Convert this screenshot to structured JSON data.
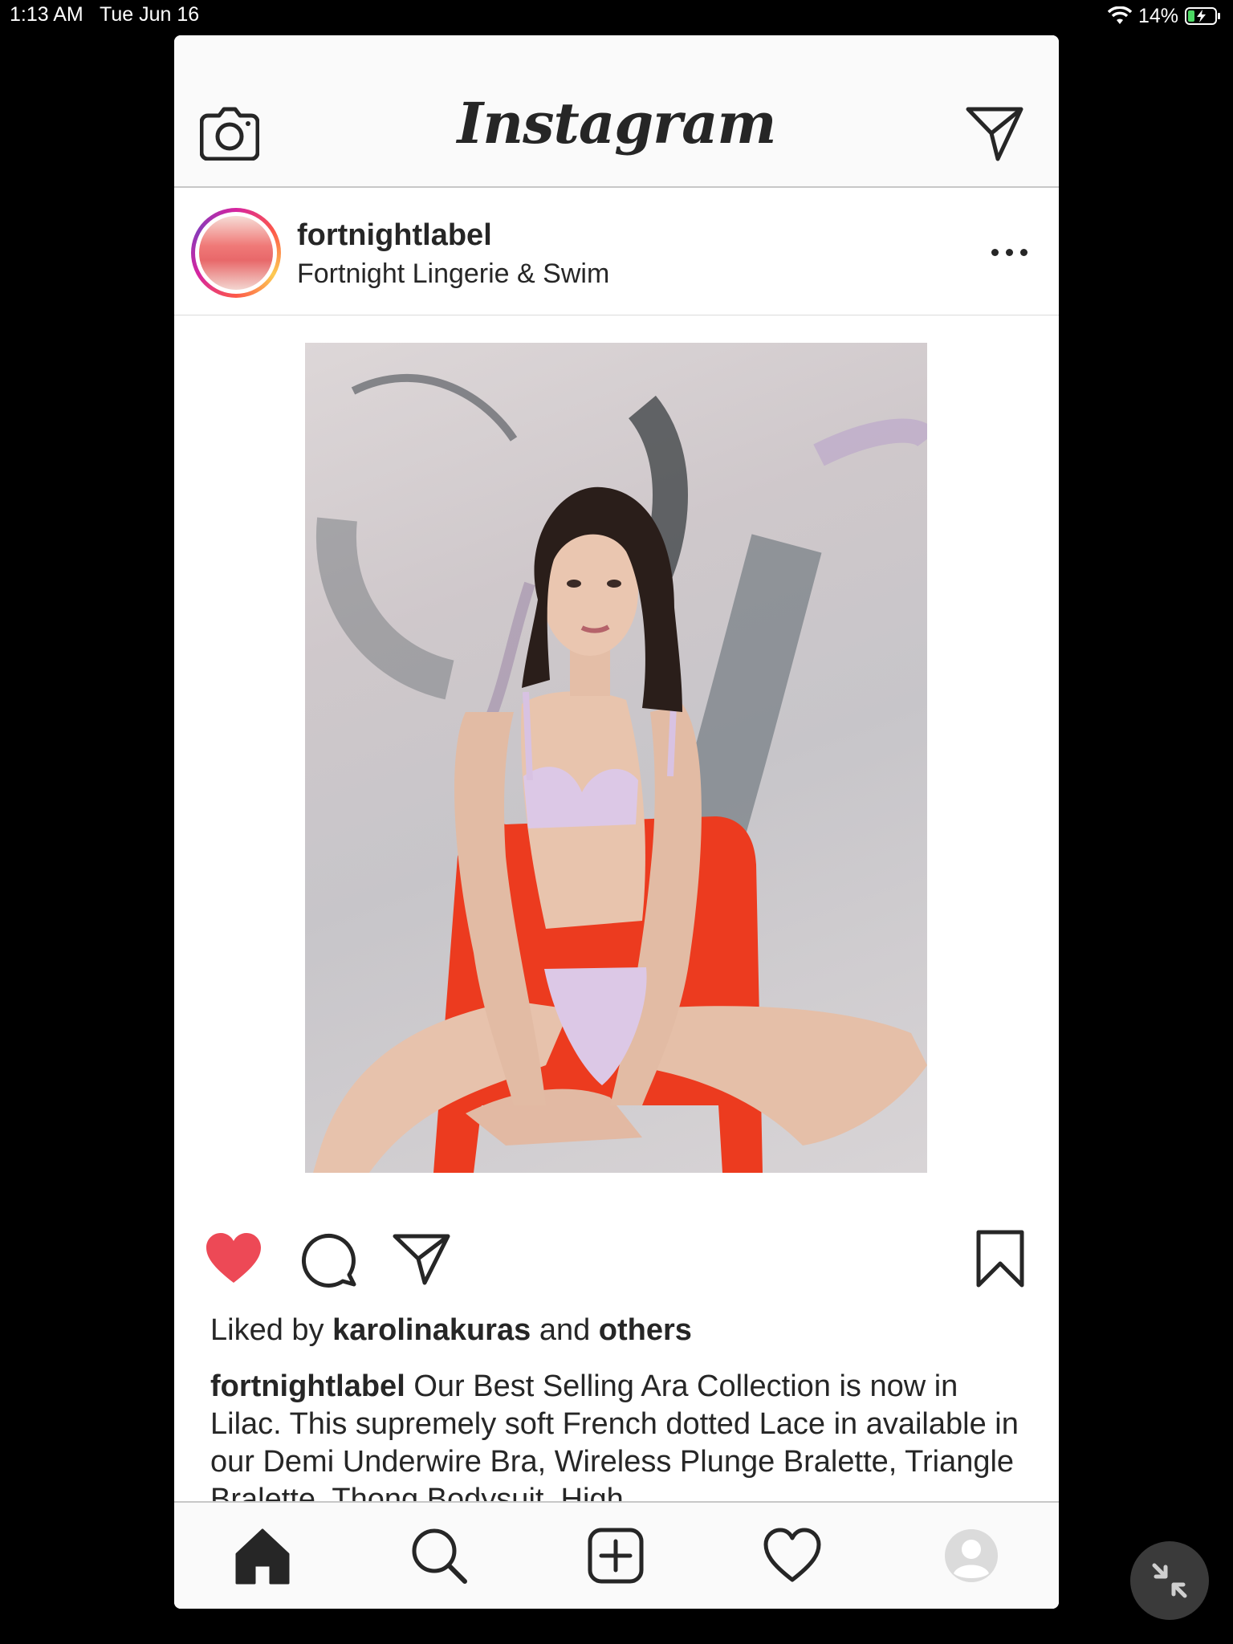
{
  "status_bar": {
    "time": "1:13 AM",
    "date": "Tue Jun 16",
    "battery": "14%"
  },
  "header": {
    "logo": "Instagram",
    "camera_icon": "camera-icon",
    "direct_icon": "paper-plane-icon"
  },
  "post": {
    "username": "fortnightlabel",
    "full_name": "Fortnight Lingerie & Swim",
    "more_icon": "ellipsis-icon",
    "liked_prefix": "Liked by",
    "liked_user": "karolinakuras",
    "liked_and": "and",
    "liked_others": "others",
    "caption_user": "fortnightlabel",
    "caption_text": "Our Best Selling Ara Collection is now in Lilac. This supremely soft French dotted Lace in available in our Demi Underwire Bra, Wireless Plunge Bralette, Triangle Bralette, Thong Bodysuit, High",
    "liked": true
  },
  "colors": {
    "heart": "#ed4956",
    "text": "#262626"
  },
  "bottom_nav": [
    "home-icon",
    "search-icon",
    "add-post-icon",
    "heart-outline-icon",
    "profile-icon"
  ]
}
